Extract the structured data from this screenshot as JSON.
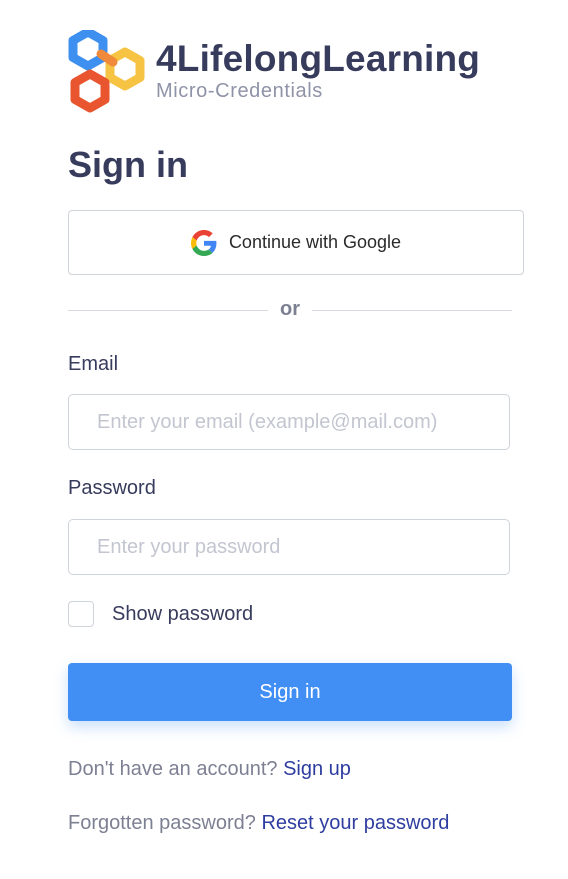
{
  "brand": {
    "name": "4LifelongLearning",
    "tagline": "Micro-Credentials",
    "colors": {
      "blue": "#3d8ff0",
      "yellow": "#f6c343",
      "red": "#e8552f",
      "text": "#373b5c"
    }
  },
  "page_title": "Sign in",
  "google_button": {
    "label": "Continue with Google",
    "icon": "google-icon"
  },
  "divider_text": "or",
  "email": {
    "label": "Email",
    "placeholder": "Enter your email (example@mail.com)",
    "value": ""
  },
  "password": {
    "label": "Password",
    "placeholder": "Enter your password",
    "value": ""
  },
  "show_password": {
    "label": "Show password",
    "checked": false
  },
  "signin_button": {
    "label": "Sign in",
    "color": "#418ff5"
  },
  "footer": {
    "signup_prompt": "Don't have an account?",
    "signup_link": "Sign up",
    "reset_prompt": "Forgotten password?",
    "reset_link": "Reset your password"
  }
}
